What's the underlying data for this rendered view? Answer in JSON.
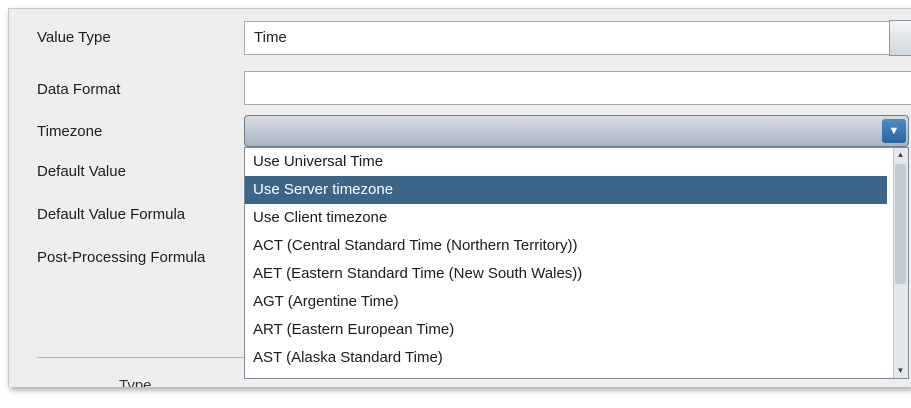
{
  "form": {
    "value_type_label": "Value Type",
    "value_type_value": "Time",
    "data_format_label": "Data Format",
    "data_format_value": "",
    "timezone_label": "Timezone",
    "timezone_value": "",
    "default_value_label": "Default Value",
    "default_value_formula_label": "Default Value Formula",
    "post_processing_formula_label": "Post-Processing Formula",
    "partial_label": "Type"
  },
  "timezone_dropdown": {
    "options": [
      "Use Universal Time",
      "Use Server timezone",
      "Use Client timezone",
      "ACT (Central Standard Time (Northern Territory))",
      "AET (Eastern Standard Time (New South Wales))",
      "AGT (Argentine Time)",
      "ART (Eastern European Time)",
      "AST (Alaska Standard Time)"
    ],
    "selected_option": "Use Server timezone"
  },
  "icons": {
    "dropdown_arrow": "chevron-down-icon",
    "scroll_up": "scroll-up-icon",
    "scroll_down": "scroll-down-icon"
  },
  "colors": {
    "selection": "#3b6688",
    "combo_arrow": "#2b64a0",
    "panel_background": "#eeeeee"
  }
}
